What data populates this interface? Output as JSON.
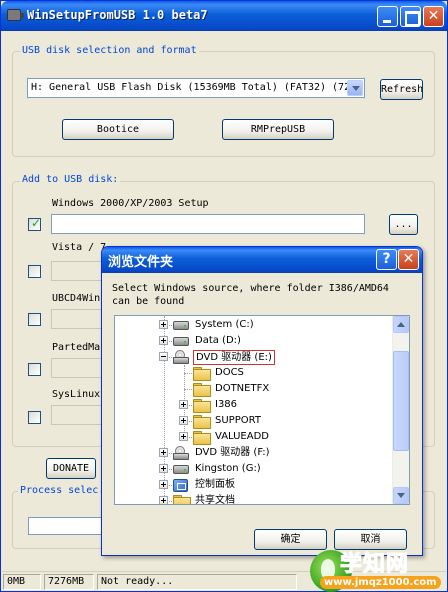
{
  "window": {
    "title": "WinSetupFromUSB 1.0 beta7"
  },
  "usb_section": {
    "label": "USB disk selection and format",
    "disk_value": "H: General USB Flash Disk (15369MB Total) (FAT32) (72",
    "refresh_label": "Refresh",
    "bootice_label": "Bootice",
    "rmprep_label": "RMPrepUSB"
  },
  "add_section": {
    "label": "Add to USB disk:",
    "items": [
      {
        "label": "Windows 2000/XP/2003 Setup",
        "checked": true,
        "browse_label": "..."
      },
      {
        "label": "Vista / 7",
        "checked": false
      },
      {
        "label": "UBCD4Win",
        "checked": false
      },
      {
        "label": "PartedMa",
        "checked": false
      },
      {
        "label": "SysLinux",
        "checked": false
      }
    ]
  },
  "donate_label": "DONATE",
  "process_label": "Process selec",
  "statusbar": {
    "size": "0MB",
    "free": "7276MB",
    "status": "Not ready..."
  },
  "dialog": {
    "title": "浏览文件夹",
    "description": "Select Windows source, where folder I386/AMD64 can be found",
    "tree": [
      {
        "label": "System (C:)",
        "icon": "drive-icon",
        "level": 0,
        "expander": "plus"
      },
      {
        "label": "Data (D:)",
        "icon": "drive-icon",
        "level": 0,
        "expander": "plus"
      },
      {
        "label": "DVD 驱动器 (E:)",
        "icon": "dvd-drive-icon",
        "level": 0,
        "expander": "minus",
        "selected": true
      },
      {
        "label": "DOCS",
        "icon": "folder-icon",
        "level": 1,
        "expander": "none"
      },
      {
        "label": "DOTNETFX",
        "icon": "folder-icon",
        "level": 1,
        "expander": "none"
      },
      {
        "label": "I386",
        "icon": "folder-icon",
        "level": 1,
        "expander": "plus"
      },
      {
        "label": "SUPPORT",
        "icon": "folder-icon",
        "level": 1,
        "expander": "plus"
      },
      {
        "label": "VALUEADD",
        "icon": "folder-icon",
        "level": 1,
        "expander": "plus"
      },
      {
        "label": "DVD 驱动器 (F:)",
        "icon": "dvd-drive-icon",
        "level": 0,
        "expander": "plus"
      },
      {
        "label": "Kingston (G:)",
        "icon": "drive-icon",
        "level": 0,
        "expander": "plus"
      },
      {
        "label": "控制面板",
        "icon": "control-panel-icon",
        "level": 0,
        "expander": "plus"
      },
      {
        "label": "共享文档",
        "icon": "folder-icon",
        "level": 0,
        "expander": "plus"
      }
    ],
    "ok_label": "确定",
    "cancel_label": "取消"
  },
  "watermark": {
    "brand": "学知网",
    "url": "www.jmqz1000.com"
  }
}
